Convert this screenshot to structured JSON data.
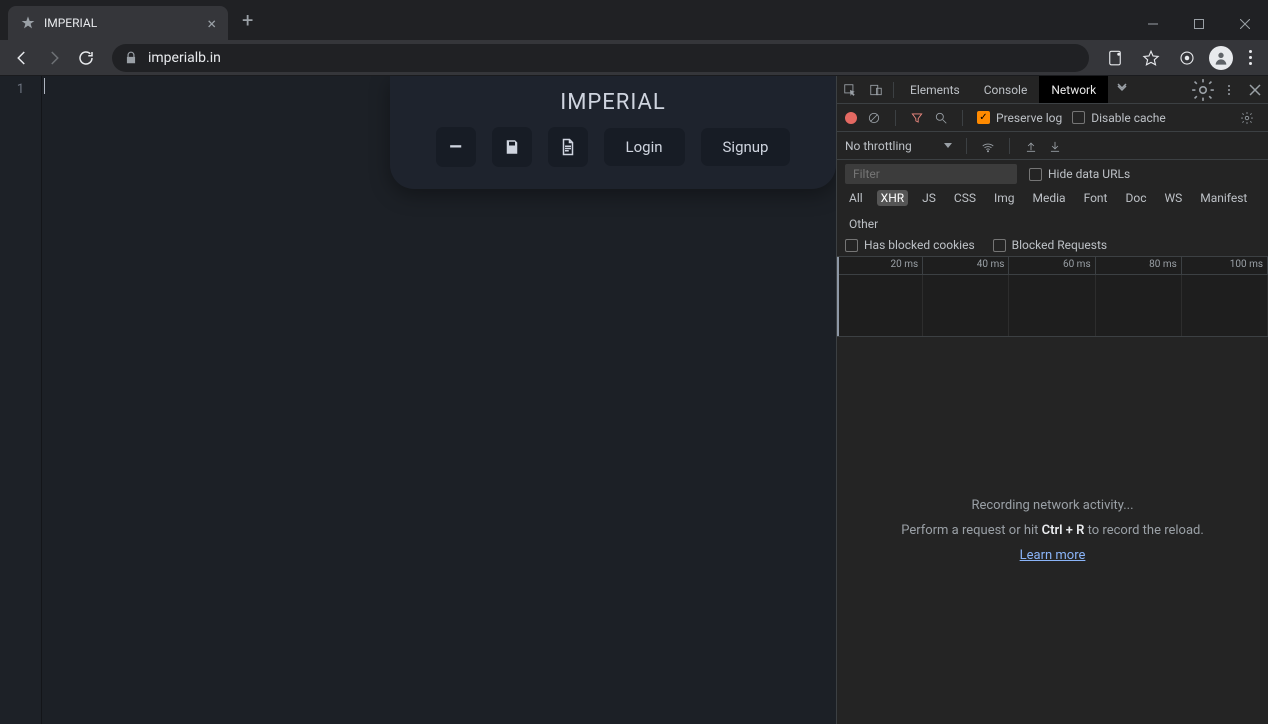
{
  "browser": {
    "tab_title": "IMPERIAL",
    "url": "imperialb.in"
  },
  "page": {
    "title": "IMPERIAL",
    "line_number": "1",
    "login_label": "Login",
    "signup_label": "Signup"
  },
  "devtools": {
    "tabs": {
      "elements": "Elements",
      "console": "Console",
      "network": "Network"
    },
    "preserve_log": "Preserve log",
    "disable_cache": "Disable cache",
    "throttling": "No throttling",
    "filter_placeholder": "Filter",
    "hide_data_urls": "Hide data URLs",
    "types": {
      "all": "All",
      "xhr": "XHR",
      "js": "JS",
      "css": "CSS",
      "img": "Img",
      "media": "Media",
      "font": "Font",
      "doc": "Doc",
      "ws": "WS",
      "manifest": "Manifest",
      "other": "Other"
    },
    "has_blocked_cookies": "Has blocked cookies",
    "blocked_requests": "Blocked Requests",
    "timeline": [
      "20 ms",
      "40 ms",
      "60 ms",
      "80 ms",
      "100 ms"
    ],
    "empty": {
      "line1": "Recording network activity...",
      "pre": "Perform a request or hit ",
      "kbd": "Ctrl + R",
      "post": " to record the reload.",
      "link": "Learn more"
    }
  }
}
